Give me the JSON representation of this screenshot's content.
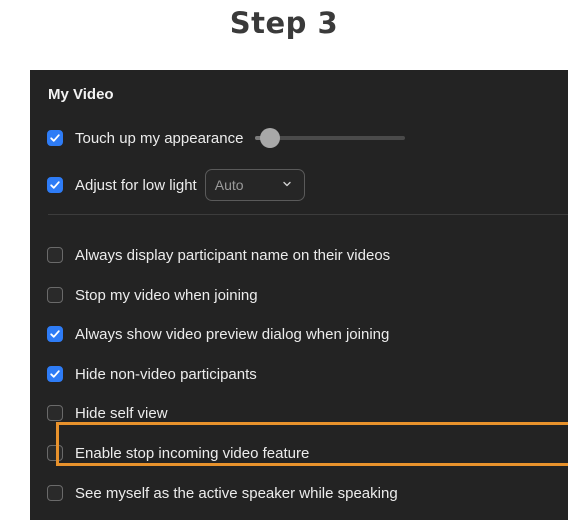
{
  "step_title": "Step 3",
  "section": {
    "heading": "My Video"
  },
  "touch_up": {
    "label": "Touch up my appearance",
    "checked": true,
    "slider_level": 0.1
  },
  "low_light": {
    "label": "Adjust for low light",
    "checked": true,
    "select_value": "Auto"
  },
  "options": [
    {
      "label": "Always display participant name on their videos",
      "checked": false
    },
    {
      "label": "Stop my video when joining",
      "checked": false
    },
    {
      "label": "Always show video preview dialog when joining",
      "checked": true
    },
    {
      "label": "Hide non-video participants",
      "checked": true,
      "highlighted": true
    },
    {
      "label": "Hide self view",
      "checked": false
    },
    {
      "label": "Enable stop incoming video feature",
      "checked": false
    },
    {
      "label": "See myself as the active speaker while speaking",
      "checked": false
    }
  ],
  "colors": {
    "panel_bg": "#232323",
    "checkbox_checked": "#2e7cf6",
    "highlight_border": "#e8922c",
    "title_text": "#3a3a3a"
  },
  "icons": {
    "checkmark": "checkmark-icon",
    "chevron": "chevron-down-icon"
  }
}
